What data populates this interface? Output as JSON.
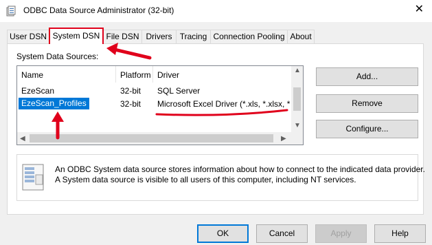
{
  "window": {
    "title": "ODBC Data Source Administrator (32-bit)",
    "close_glyph": "✕"
  },
  "tabs": [
    {
      "label": "User DSN"
    },
    {
      "label": "System DSN"
    },
    {
      "label": "File DSN"
    },
    {
      "label": "Drivers"
    },
    {
      "label": "Tracing"
    },
    {
      "label": "Connection Pooling"
    },
    {
      "label": "About"
    }
  ],
  "active_tab": "System DSN",
  "section_label": "System Data Sources:",
  "list": {
    "columns": [
      "Name",
      "Platform",
      "Driver"
    ],
    "rows": [
      {
        "name": "EzeScan",
        "platform": "32-bit",
        "driver": "SQL Server"
      },
      {
        "name": "EzeScan_Profiles",
        "platform": "32-bit",
        "driver": "Microsoft Excel Driver (*.xls, *.xlsx, *.xlsm"
      }
    ],
    "selected_row": 1
  },
  "side_buttons": {
    "add": "Add...",
    "remove": "Remove",
    "configure": "Configure..."
  },
  "info": {
    "line1": "An ODBC System data source stores information about how to connect to the indicated data provider.",
    "line2": "A System data source is visible to all users of this computer, including NT services."
  },
  "footer_buttons": {
    "ok": "OK",
    "cancel": "Cancel",
    "apply": "Apply",
    "help": "Help"
  },
  "annotation_color": "#e0001b",
  "selection_color": "#0078d7"
}
